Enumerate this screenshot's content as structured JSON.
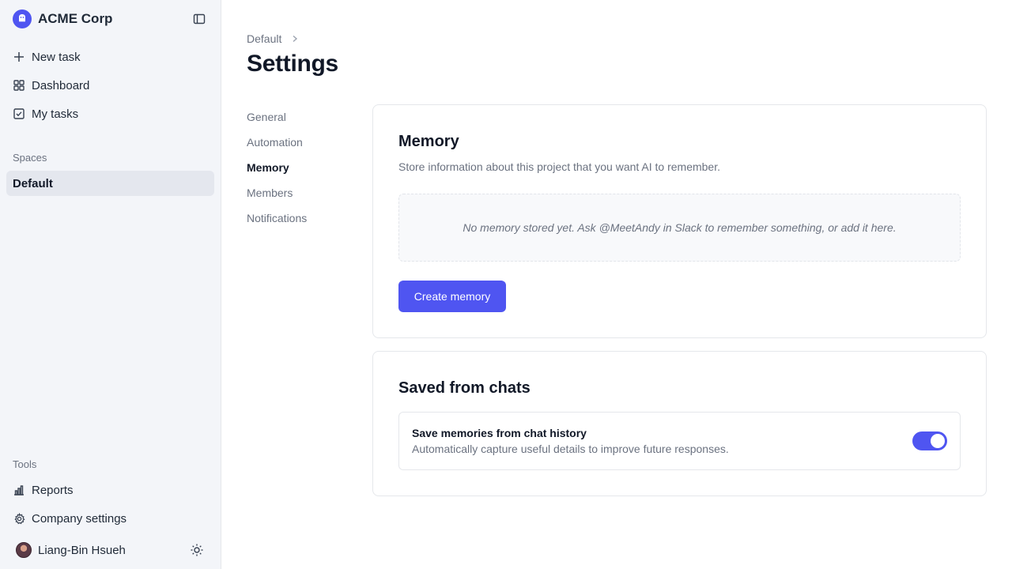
{
  "sidebar": {
    "brand": "ACME Corp",
    "nav": [
      {
        "label": "New task",
        "icon": "plus-icon"
      },
      {
        "label": "Dashboard",
        "icon": "grid-icon"
      },
      {
        "label": "My tasks",
        "icon": "checkbox-icon"
      }
    ],
    "spaces_label": "Spaces",
    "spaces": [
      {
        "label": "Default",
        "selected": true
      }
    ],
    "tools_label": "Tools",
    "tools": [
      {
        "label": "Reports",
        "icon": "bar-chart-icon"
      },
      {
        "label": "Company settings",
        "icon": "gear-icon"
      }
    ],
    "user": {
      "name": "Liang-Bin Hsueh"
    }
  },
  "header": {
    "breadcrumb": "Default",
    "title": "Settings"
  },
  "settings_nav": [
    {
      "label": "General",
      "active": false
    },
    {
      "label": "Automation",
      "active": false
    },
    {
      "label": "Memory",
      "active": true
    },
    {
      "label": "Members",
      "active": false
    },
    {
      "label": "Notifications",
      "active": false
    }
  ],
  "memory": {
    "title": "Memory",
    "description": "Store information about this project that you want AI to remember.",
    "empty_message": "No memory stored yet. Ask @MeetAndy in Slack to remember something, or add it here.",
    "create_label": "Create memory"
  },
  "saved_chats": {
    "title": "Saved from chats",
    "setting_label": "Save memories from chat history",
    "setting_help": "Automatically capture useful details to improve future responses.",
    "enabled": true
  },
  "colors": {
    "accent": "#4f55f1",
    "sidebar_bg": "#f3f5f9"
  }
}
